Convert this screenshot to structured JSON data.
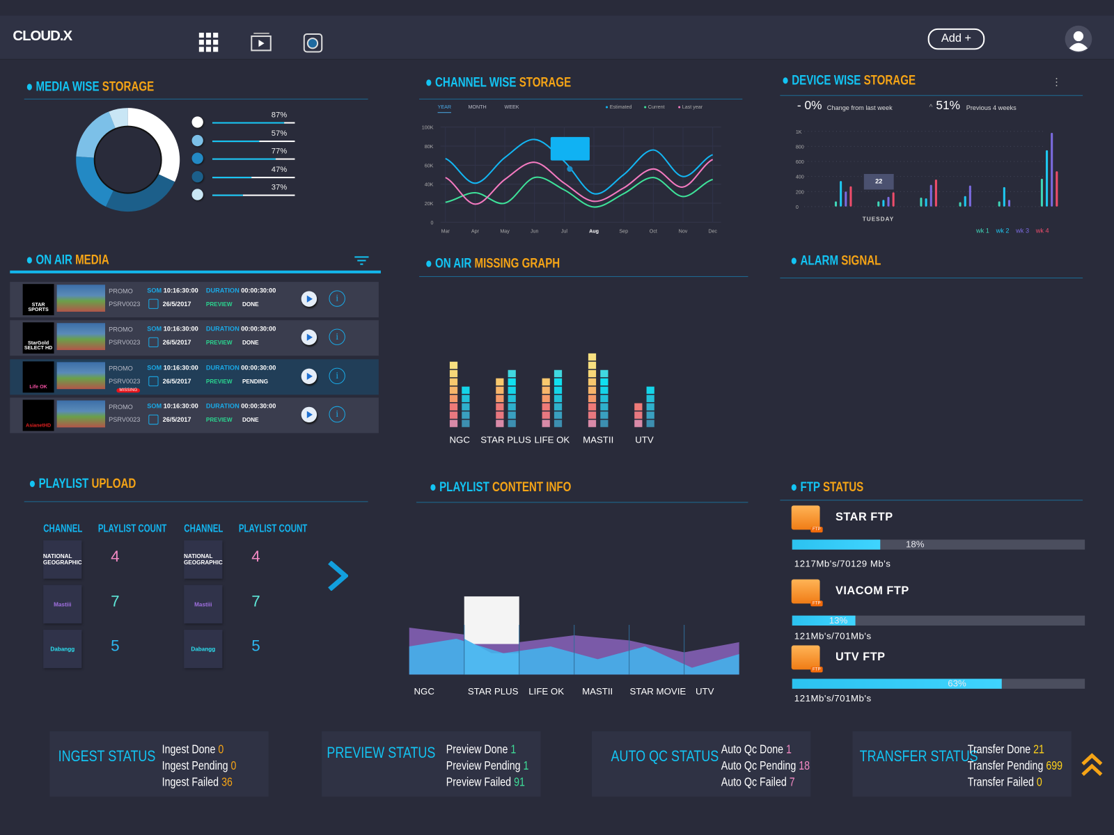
{
  "header": {
    "logo": "CLOUD.X",
    "icons": [
      "apps-grid-icon",
      "video-library-icon",
      "camera-icon"
    ],
    "add_button": "Add +",
    "avatar": "user-avatar-icon"
  },
  "colors": {
    "accent": "#13c4f3",
    "orange": "#f5a416",
    "background": "#292b3a",
    "panel": "#2f3244"
  },
  "media_storage": {
    "title_a": "MEDIA WISE",
    "title_b": "STORAGE",
    "legend": [
      {
        "value": "87%",
        "pct": 87,
        "color": "#ffffff"
      },
      {
        "value": "57%",
        "pct": 57,
        "color": "#7cc0e8"
      },
      {
        "value": "77%",
        "pct": 77,
        "color": "#2389c4"
      },
      {
        "value": "47%",
        "pct": 47,
        "color": "#1c5f8a"
      },
      {
        "value": "37%",
        "pct": 37,
        "color": "#c9e6f5"
      }
    ]
  },
  "channel_storage": {
    "title_a": "CHANNEL WISE",
    "title_b": "STORAGE",
    "tabs": [
      "YEAR",
      "MONTH",
      "WEEK"
    ],
    "active_tab": "YEAR"
  },
  "device_storage": {
    "title_a": "DEVICE WISE",
    "title_b": "STORAGE",
    "change": "0%",
    "change_prefix": "-",
    "change_label": "Change from last week",
    "prev": "51%",
    "prev_prefix": "^",
    "prev_label": "Previous 4 weeks",
    "tooltip": "22",
    "day_label": "TUESDAY"
  },
  "on_air": {
    "title_a": "ON AIR",
    "title_b": "MEDIA",
    "rows": [
      {
        "logo": "STAR SPORTS",
        "logo_color": "#ffffff",
        "type": "PROMO",
        "id": "PSRV0023",
        "som_label": "SOM",
        "som": "10:16:30:00",
        "dur_label": "DURATION",
        "duration": "00:00:30:00",
        "date": "26/5/2017",
        "preview": "PREVIEW",
        "status": "DONE",
        "missing": ""
      },
      {
        "logo": "StarGold SELECT HD",
        "logo_color": "#ffffff",
        "type": "PROMO",
        "id": "PSRV0023",
        "som_label": "SOM",
        "som": "10:16:30:00",
        "dur_label": "DURATION",
        "duration": "00:00:30:00",
        "date": "26/5/2017",
        "preview": "PREVIEW",
        "status": "DONE",
        "missing": ""
      },
      {
        "logo": "Life OK",
        "logo_color": "#f04fa0",
        "type": "PROMO",
        "id": "PSRV0023",
        "som_label": "SOM",
        "som": "10:16:30:00",
        "dur_label": "DURATION",
        "duration": "00:00:30:00",
        "date": "26/5/2017",
        "preview": "PREVIEW",
        "status": "PENDING",
        "missing": "MISSING"
      },
      {
        "logo": "AsianetHD",
        "logo_color": "#e02020",
        "type": "PROMO",
        "id": "PSRV0023",
        "som_label": "SOM",
        "som": "10:16:30:00",
        "dur_label": "DURATION",
        "duration": "00:00:30:00",
        "date": "26/5/2017",
        "preview": "PREVIEW",
        "status": "DONE",
        "missing": ""
      }
    ]
  },
  "missing_graph": {
    "title_a": "ON AIR",
    "title_b": "MISSING GRAPH"
  },
  "alarm": {
    "title_a": "ALARM",
    "title_b": "SIGNAL"
  },
  "playlist_upload": {
    "title_a": "PLAYLIST",
    "title_b": "UPLOAD",
    "col_channel": "CHANNEL",
    "col_count": "PLAYLIST COUNT",
    "columns": [
      [
        {
          "channel": "NATIONAL GEOGRAPHIC",
          "count": "4",
          "color": "#f48ac4"
        },
        {
          "channel": "Mastiii",
          "count": "7",
          "color": "#5ee8d8"
        },
        {
          "channel": "Dabangg",
          "count": "5",
          "color": "#2cb8f0"
        }
      ],
      [
        {
          "channel": "NATIONAL GEOGRAPHIC",
          "count": "4",
          "color": "#f48ac4"
        },
        {
          "channel": "Mastiii",
          "count": "7",
          "color": "#5ee8d8"
        },
        {
          "channel": "Dabangg",
          "count": "5",
          "color": "#2cb8f0"
        }
      ]
    ]
  },
  "playlist_content": {
    "title_a": "PLAYLIST",
    "title_b": "CONTENT INFO"
  },
  "ftp": {
    "title_a": "FTP",
    "title_b": "STATUS",
    "items": [
      {
        "name": "STAR FTP",
        "pct": 18,
        "pct_label": "18%",
        "usage": "1217Mb's/70129 Mb's"
      },
      {
        "name": "VIACOM FTP",
        "pct": 13,
        "pct_label": "13%",
        "usage": "121Mb's/701Mb's"
      },
      {
        "name": "UTV FTP",
        "pct": 63,
        "pct_label": "63%",
        "usage": "121Mb's/701Mb's"
      }
    ]
  },
  "status_cards": [
    {
      "title": "INGEST STATUS",
      "lines": [
        {
          "label": "Ingest Done",
          "value": "0"
        },
        {
          "label": "Ingest Pending",
          "value": "0"
        },
        {
          "label": "Ingest Failed",
          "value": "36"
        }
      ],
      "value_color": "#f5a416"
    },
    {
      "title": "PREVIEW STATUS",
      "lines": [
        {
          "label": "Preview Done",
          "value": "1"
        },
        {
          "label": "Preview Pending",
          "value": "1"
        },
        {
          "label": "Preview Failed",
          "value": "91"
        }
      ],
      "value_color": "#3ddc97"
    },
    {
      "title": "AUTO QC STATUS",
      "lines": [
        {
          "label": "Auto Qc Done",
          "value": "1"
        },
        {
          "label": "Auto Qc Pending",
          "value": "18"
        },
        {
          "label": "Auto Qc Failed",
          "value": "7"
        }
      ],
      "value_color": "#f48ac4"
    },
    {
      "title": "TRANSFER STATUS",
      "lines": [
        {
          "label": "Transfer Done",
          "value": "21"
        },
        {
          "label": "Transfer Pending",
          "value": "699"
        },
        {
          "label": "Transfer Failed",
          "value": "0"
        }
      ],
      "value_color": "#ffd21a"
    }
  ],
  "chart_data": [
    {
      "type": "pie",
      "variant": "donut",
      "values": [
        32,
        25,
        19,
        18,
        6
      ],
      "colors": [
        "#ffffff",
        "#1c5f8a",
        "#2389c4",
        "#7cc0e8",
        "#c9e6f5"
      ]
    },
    {
      "type": "line",
      "categories": [
        "Mar",
        "Apr",
        "May",
        "Jun",
        "Jul",
        "Aug",
        "Sep",
        "Oct",
        "Nov",
        "Dec"
      ],
      "highlight": "Aug",
      "yticks": [
        "0",
        "20K",
        "40K",
        "60K",
        "80K",
        "100K"
      ],
      "ylim": [
        0,
        100000
      ],
      "legend_placement": "top-right",
      "series": [
        {
          "name": "Estimated",
          "color": "#13b6f3",
          "values": [
            67000,
            41000,
            68000,
            87000,
            64000,
            30000,
            50000,
            76000,
            48000,
            71000
          ]
        },
        {
          "name": "Current",
          "color": "#3ee39a",
          "values": [
            21000,
            31000,
            20000,
            47000,
            34000,
            16000,
            30000,
            47000,
            27000,
            45000
          ]
        },
        {
          "name": "Last year",
          "color": "#f47ac0",
          "values": [
            47000,
            19000,
            45000,
            63000,
            41000,
            22000,
            36000,
            56000,
            37000,
            66000
          ]
        }
      ]
    },
    {
      "type": "bar",
      "yticks": [
        "0",
        "200",
        "400",
        "600",
        "800",
        "1K"
      ],
      "ylim": [
        0,
        1000
      ],
      "groups": 6,
      "series": [
        {
          "name": "wk 1",
          "color": "#3fd6b8",
          "values": [
            70,
            70,
            120,
            60,
            70,
            370
          ]
        },
        {
          "name": "wk 2",
          "color": "#1ec8f0",
          "values": [
            340,
            90,
            110,
            140,
            260,
            750
          ]
        },
        {
          "name": "wk 3",
          "color": "#7b6be0",
          "values": [
            200,
            130,
            290,
            280,
            90,
            980
          ]
        },
        {
          "name": "wk 4",
          "color": "#ef4d6b",
          "values": [
            270,
            190,
            360,
            0,
            0,
            470
          ]
        }
      ]
    },
    {
      "type": "bar",
      "variant": "segmented",
      "categories": [
        "NGC",
        "STAR PLUS",
        "LIFE OK",
        "MASTII",
        "UTV"
      ],
      "series": [
        {
          "values": [
            8,
            6,
            6,
            9,
            3
          ]
        },
        {
          "values": [
            5,
            7,
            7,
            7,
            5
          ]
        }
      ]
    },
    {
      "type": "area",
      "categories": [
        "NGC",
        "STAR PLUS",
        "LIFE OK",
        "MASTII",
        "STAR MOVIE",
        "UTV"
      ],
      "highlight": "STAR PLUS",
      "series": [
        {
          "color": "#7a5aa8",
          "values": [
            55,
            47,
            38,
            46,
            40,
            26,
            38
          ]
        },
        {
          "color": "#4aa8e4",
          "values": [
            33,
            42,
            25,
            33,
            18,
            33,
            8,
            24
          ]
        }
      ]
    }
  ]
}
